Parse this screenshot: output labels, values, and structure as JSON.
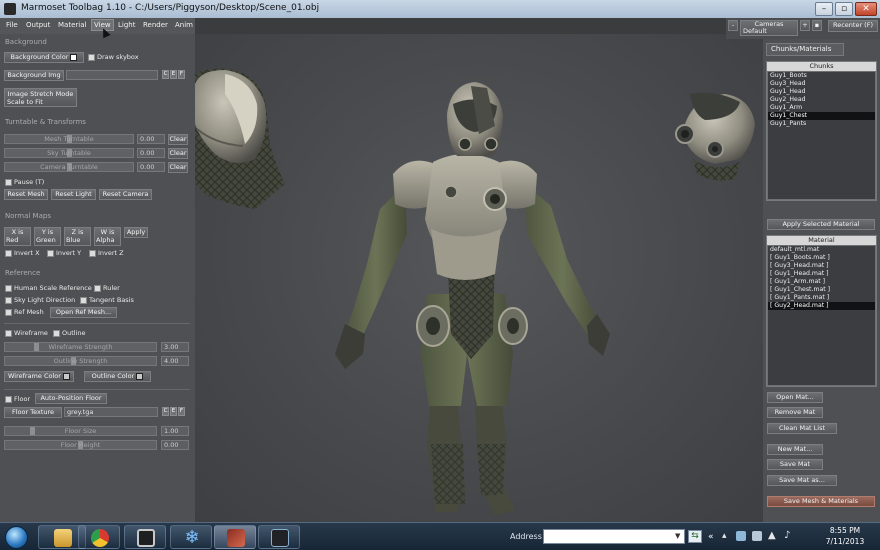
{
  "window": {
    "title": "Marmoset Toolbag 1.10 - C:/Users/Piggyson/Desktop/Scene_01.obj"
  },
  "menu": {
    "items": [
      "File",
      "Output",
      "Material",
      "View",
      "Light",
      "Render",
      "Anim"
    ],
    "active": "View"
  },
  "left_panel": {
    "background": {
      "section": "Background",
      "bg_color_button": "Background Color",
      "bg_color_swatch": "#ffffff",
      "draw_skybox": "Draw skybox",
      "bg_img_button": "Background Img",
      "stretch_button_line1": "Image Stretch Mode",
      "stretch_button_line2": "Scale to Fit"
    },
    "turntable": {
      "section": "Turntable & Transforms",
      "sliders": [
        {
          "label": "Mesh Turntable",
          "value": "0.00",
          "clear": "Clear",
          "fraction": 0.5
        },
        {
          "label": "Sky Turntable",
          "value": "0.00",
          "clear": "Clear",
          "fraction": 0.5
        },
        {
          "label": "Camera Turntable",
          "value": "0.00",
          "clear": "Clear",
          "fraction": 0.5
        }
      ],
      "pause": "Pause (T)",
      "reset_mesh": "Reset Mesh",
      "reset_light": "Reset Light",
      "reset_camera": "Reset Camera"
    },
    "normal_maps": {
      "section": "Normal Maps",
      "buttons": [
        {
          "top": "X is",
          "bottom": "Red"
        },
        {
          "top": "Y is",
          "bottom": "Green"
        },
        {
          "top": "Z is",
          "bottom": "Blue"
        },
        {
          "top": "W is",
          "bottom": "Alpha"
        }
      ],
      "apply": "Apply",
      "invert_x": "Invert X",
      "invert_y": "Invert Y",
      "invert_z": "Invert Z"
    },
    "reference": {
      "section": "Reference",
      "human_scale": "Human Scale Reference",
      "ruler": "Ruler",
      "sky_light": "Sky Light Direction",
      "tangent_basis": "Tangent Basis",
      "ref_mesh": "Ref Mesh",
      "open_ref_mesh": "Open Ref Mesh..."
    },
    "wireframe": {
      "wireframe": "Wireframe",
      "outline": "Outline",
      "strength_label": "Wireframe Strength",
      "strength_value": "3.00",
      "strength_fraction": 0.2,
      "outline_strength_label": "Outline Strength",
      "outline_strength_value": "4.00",
      "outline_fraction": 0.45,
      "wire_color_button": "Wireframe Color",
      "outline_color_button": "Outline Color",
      "wire_color": "#c8c8c8",
      "outline_color": "#c8c8c8"
    },
    "floor": {
      "floor": "Floor",
      "auto_position": "Auto-Position Floor",
      "floor_texture_button": "Floor Texture",
      "floor_texture_value": "grey.tga",
      "size_label": "Floor Size",
      "size_value": "1.00",
      "size_fraction": 0.17,
      "height_label": "Floor Height",
      "height_value": "0.00",
      "height_fraction": 0.5
    },
    "mini_buttons": [
      "C",
      "E",
      "F"
    ]
  },
  "top_right": {
    "minus": "-",
    "cameras_label": "Cameras",
    "cameras_value": "Default",
    "plus": "+",
    "recenter": "Recenter (F)"
  },
  "right_panel": {
    "tab": "Chunks/Materials",
    "chunks_header": "Chunks",
    "chunks": [
      "Guy1_Boots",
      "Guy3_Head",
      "Guy1_Head",
      "Guy2_Head",
      "Guy1_Arm",
      "Guy1_Chest",
      "Guy1_Pants"
    ],
    "selected_chunk": "Guy1_Chest",
    "apply_selected": "Apply Selected Material",
    "material_header": "Material",
    "materials": [
      "default_mtl.mat",
      "[ Guy1_Boots.mat ]",
      "[ Guy3_Head.mat ]",
      "[ Guy1_Head.mat ]",
      "[ Guy1_Arm.mat ]",
      "[ Guy1_Chest.mat ]",
      "[ Guy1_Pants.mat ]",
      "[ Guy2_Head.mat ]"
    ],
    "selected_material": "[ Guy2_Head.mat ]",
    "open_mat": "Open Mat...",
    "remove_mat": "Remove Mat",
    "clean_mat_list": "Clean Mat List",
    "new_mat": "New Mat...",
    "save_mat": "Save Mat",
    "save_mat_as": "Save Mat as...",
    "save_mesh_materials": "Save Mesh & Materials"
  },
  "taskbar": {
    "address_label": "Address",
    "time": "8:55 PM",
    "date": "7/11/2013",
    "apps": [
      "explorer-icon",
      "chrome-icon",
      "app-icon",
      "snowflake-icon",
      "marmoset-icon",
      "toolbag-icon"
    ]
  },
  "colors": {
    "panel": "#4e5053",
    "accent_button": "#8a5a4e",
    "selection": "#111214"
  }
}
